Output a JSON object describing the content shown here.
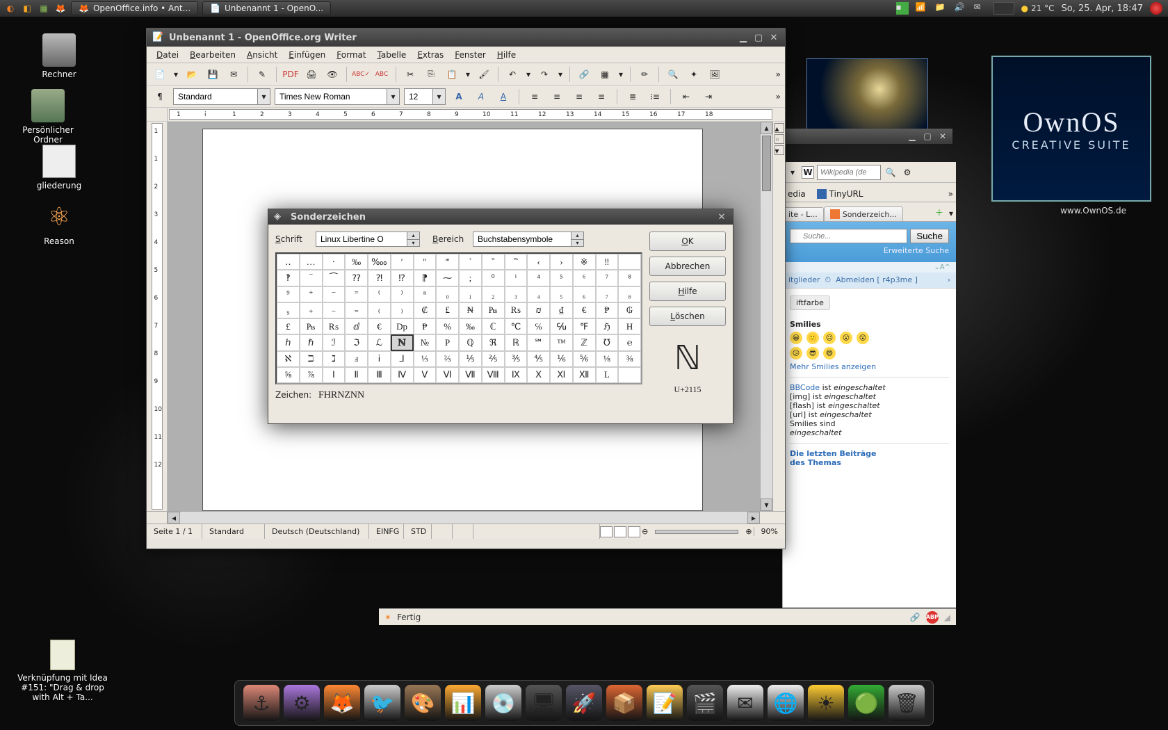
{
  "top_panel": {
    "tasks": [
      {
        "icon": "firefox",
        "label": "OpenOffice.info • Ant..."
      },
      {
        "icon": "document",
        "label": "Unbenannt 1 - OpenO..."
      }
    ],
    "weather": "21 °C",
    "date": "So, 25. Apr, 18:47"
  },
  "desktop_icons": [
    {
      "id": "rechner",
      "label": "Rechner"
    },
    {
      "id": "ordner",
      "label": "Persönlicher Ordner"
    },
    {
      "id": "gliederung",
      "label": "gliederung"
    },
    {
      "id": "reason",
      "label": "Reason"
    },
    {
      "id": "link",
      "label": "Verknüpfung mit Idea #151: \"Drag & drop with Alt + Ta..."
    }
  ],
  "ownos": {
    "title": "OwnOS",
    "sub": "CREATIVE SUITE",
    "url": "www.OwnOS.de"
  },
  "writer": {
    "title": "Unbenannt 1 - OpenOffice.org Writer",
    "menus": [
      {
        "k": "D",
        "rest": "atei"
      },
      {
        "k": "B",
        "rest": "earbeiten"
      },
      {
        "k": "A",
        "rest": "nsicht"
      },
      {
        "k": "E",
        "rest": "infügen"
      },
      {
        "k": "F",
        "rest": "ormat"
      },
      {
        "k": "T",
        "rest": "abelle"
      },
      {
        "k": "E",
        "rest": "xtras"
      },
      {
        "k": "F",
        "rest": "enster"
      },
      {
        "k": "H",
        "rest": "ilfe"
      }
    ],
    "style": "Standard",
    "font": "Times New Roman",
    "size": "12",
    "ruler_h": [
      "1",
      "i",
      "1",
      "2",
      "3",
      "4",
      "5",
      "6",
      "7",
      "8",
      "9",
      "10",
      "11",
      "12",
      "13",
      "14",
      "15",
      "16",
      "17",
      "18"
    ],
    "ruler_v": [
      "1",
      "1",
      "2",
      "3",
      "4",
      "5",
      "6",
      "7",
      "8",
      "9",
      "10",
      "11",
      "12"
    ],
    "status": {
      "page": "Seite 1 / 1",
      "style": "Standard",
      "lang": "Deutsch (Deutschland)",
      "ins": "EINFG",
      "std": "STD",
      "zoom": "90%"
    }
  },
  "sonder": {
    "title": "Sonderzeichen",
    "schrift_label": "Schrift",
    "schrift_value": "Linux Libertine O",
    "bereich_label": "Bereich",
    "bereich_value": "Buchstabensymbole",
    "btn_ok": "OK",
    "btn_cancel": "Abbrechen",
    "btn_help": "Hilfe",
    "btn_delete": "Löschen",
    "zeichen_label": "Zeichen:",
    "zeichen_value": "FHRNZNN",
    "preview_char": "ℕ",
    "unicode": "U+2115",
    "grid": [
      [
        "‥",
        "…",
        "‧",
        "‰",
        "‱",
        "′",
        "″",
        "‴",
        "‵",
        "‶",
        "‷",
        "‹",
        "›",
        "※",
        "‼",
        " "
      ],
      [
        "‽",
        "‾",
        "⁀",
        "⁇",
        "⁈",
        "⁉",
        "⁋",
        "⁓",
        ";",
        "⁰",
        "ⁱ",
        "⁴",
        "⁵",
        "⁶",
        "⁷",
        "⁸"
      ],
      [
        "⁹",
        "⁺",
        "⁻",
        "⁼",
        "⁽",
        "⁾",
        "ⁿ",
        "₀",
        "₁",
        "₂",
        "₃",
        "₄",
        "₅",
        "₆",
        "₇",
        "₈"
      ],
      [
        "₉",
        "₊",
        "₋",
        "₌",
        "₍",
        "₎",
        "₡",
        "₤",
        "₦",
        "₧",
        "₨",
        "₪",
        "₫",
        "€",
        "₱",
        "₲"
      ],
      [
        "£",
        "₧",
        "₨",
        "ⅆ",
        "€",
        "Dp",
        "₱",
        "%",
        "‰",
        "ℂ",
        "℃",
        "℅",
        "℆",
        "℉",
        "ℌ",
        "H"
      ],
      [
        "ℎ",
        "ℏ",
        "ℐ",
        "ℑ",
        "ℒ",
        "ℕ",
        "№",
        "P",
        "ℚ",
        "ℜ",
        "ℝ",
        "℠",
        "™",
        "ℤ",
        "℧",
        "℮"
      ],
      [
        "ℵ",
        "ℶ",
        "ℷ",
        "ⅎ",
        "ⅰ",
        "⅃",
        "⅓",
        "⅔",
        "⅕",
        "⅖",
        "⅗",
        "⅘",
        "⅙",
        "⅚",
        "⅛",
        "⅜"
      ],
      [
        "⅝",
        "⅞",
        "Ⅰ",
        "Ⅱ",
        "Ⅲ",
        "Ⅳ",
        "Ⅴ",
        "Ⅵ",
        "Ⅶ",
        "Ⅷ",
        "Ⅸ",
        "Ⅹ",
        "Ⅺ",
        "Ⅻ",
        "L",
        " "
      ]
    ],
    "selected_row": 5,
    "selected_col": 5
  },
  "browser": {
    "wiki_placeholder": "Wikipedia (de",
    "bookmark1": "edia",
    "bookmark2": "TinyURL",
    "tab1": "ite - L...",
    "tab2": "Sonderzeich...",
    "search_placeholder": "Suche...",
    "search_btn": "Suche",
    "adv": "Erweiterte Suche",
    "userbar_mitglieder": "itglieder",
    "userbar_abmelden": "Abmelden [ r4p3me ]",
    "shriftfarbe": "iftfarbe",
    "smilies_title": "Smilies",
    "mehr": "Mehr Smilies anzeigen",
    "bbcode": "BBCode",
    "ist": "ist",
    "on": "eingeschaltet",
    "img": "[img]",
    "flash": "[flash]",
    "url": "[url]",
    "smilies_sind": "Smilies sind",
    "letzten1": "Die letzten Beiträge",
    "letzten2": "des Themas",
    "status": "Fertig"
  },
  "dock_icons": [
    "anchor",
    "gear",
    "firefox",
    "pidgin",
    "gimp",
    "eq",
    "disc",
    "display",
    "rocket",
    "cube",
    "notes",
    "video",
    "mail",
    "globe",
    "sun",
    "sphere",
    "trash"
  ],
  "dock_weather": "21 °C"
}
